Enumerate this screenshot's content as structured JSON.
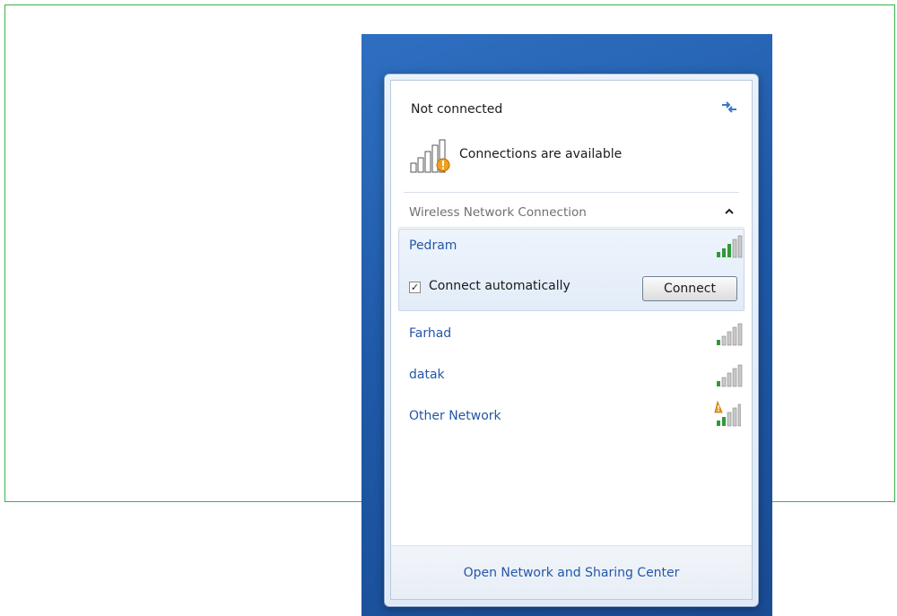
{
  "status": {
    "title": "Not connected",
    "refresh_icon": "refresh-arrows-icon",
    "availability_icon": "network-signal-warning-icon",
    "availability_text": "Connections are available"
  },
  "section": {
    "title": "Wireless Network Connection",
    "collapse_icon": "chevron-up-icon"
  },
  "networks": [
    {
      "name": "Pedram",
      "selected": true,
      "signal_icon": "wifi-signal-icon"
    },
    {
      "name": "Farhad",
      "selected": false,
      "signal_icon": "wifi-signal-icon"
    },
    {
      "name": "datak",
      "selected": false,
      "signal_icon": "wifi-signal-icon"
    },
    {
      "name": "Other Network",
      "selected": false,
      "signal_icon": "wifi-signal-unsecured-icon"
    }
  ],
  "selected_options": {
    "connect_automatically_label": "Connect automatically",
    "connect_automatically_checked": true,
    "checkmark": "✓",
    "connect_button_label": "Connect"
  },
  "footer": {
    "link_label": "Open Network and Sharing Center"
  },
  "colors": {
    "link_blue": "#2456a8",
    "desktop_blue": "#1f5aa8",
    "frame_green": "#3cb04a",
    "warning_orange": "#f0a020"
  }
}
